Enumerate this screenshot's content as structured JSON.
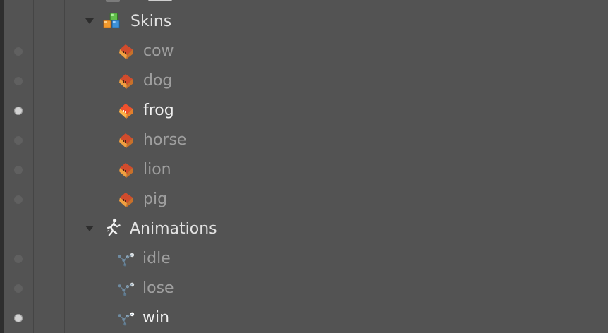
{
  "tree": {
    "skins_group": {
      "label": "Skins",
      "icon": "skins-icon",
      "expanded": true,
      "items": [
        {
          "label": "cow",
          "icon": "skin-icon",
          "active": false
        },
        {
          "label": "dog",
          "icon": "skin-icon",
          "active": false
        },
        {
          "label": "frog",
          "icon": "skin-icon",
          "active": true
        },
        {
          "label": "horse",
          "icon": "skin-icon",
          "active": false
        },
        {
          "label": "lion",
          "icon": "skin-icon",
          "active": false
        },
        {
          "label": "pig",
          "icon": "skin-icon",
          "active": false
        }
      ]
    },
    "animations_group": {
      "label": "Animations",
      "icon": "animation-run-icon",
      "expanded": true,
      "items": [
        {
          "label": "idle",
          "icon": "animation-node-icon",
          "active": false
        },
        {
          "label": "lose",
          "icon": "animation-node-icon",
          "active": false
        },
        {
          "label": "win",
          "icon": "animation-node-icon",
          "active": true
        }
      ]
    }
  },
  "colors": {
    "background": "#535353",
    "text_dim": "#9f9f9f",
    "text_bright": "#f0f0f0",
    "bullet_active": "#d2d2d2",
    "bullet_inactive": "#606060"
  }
}
